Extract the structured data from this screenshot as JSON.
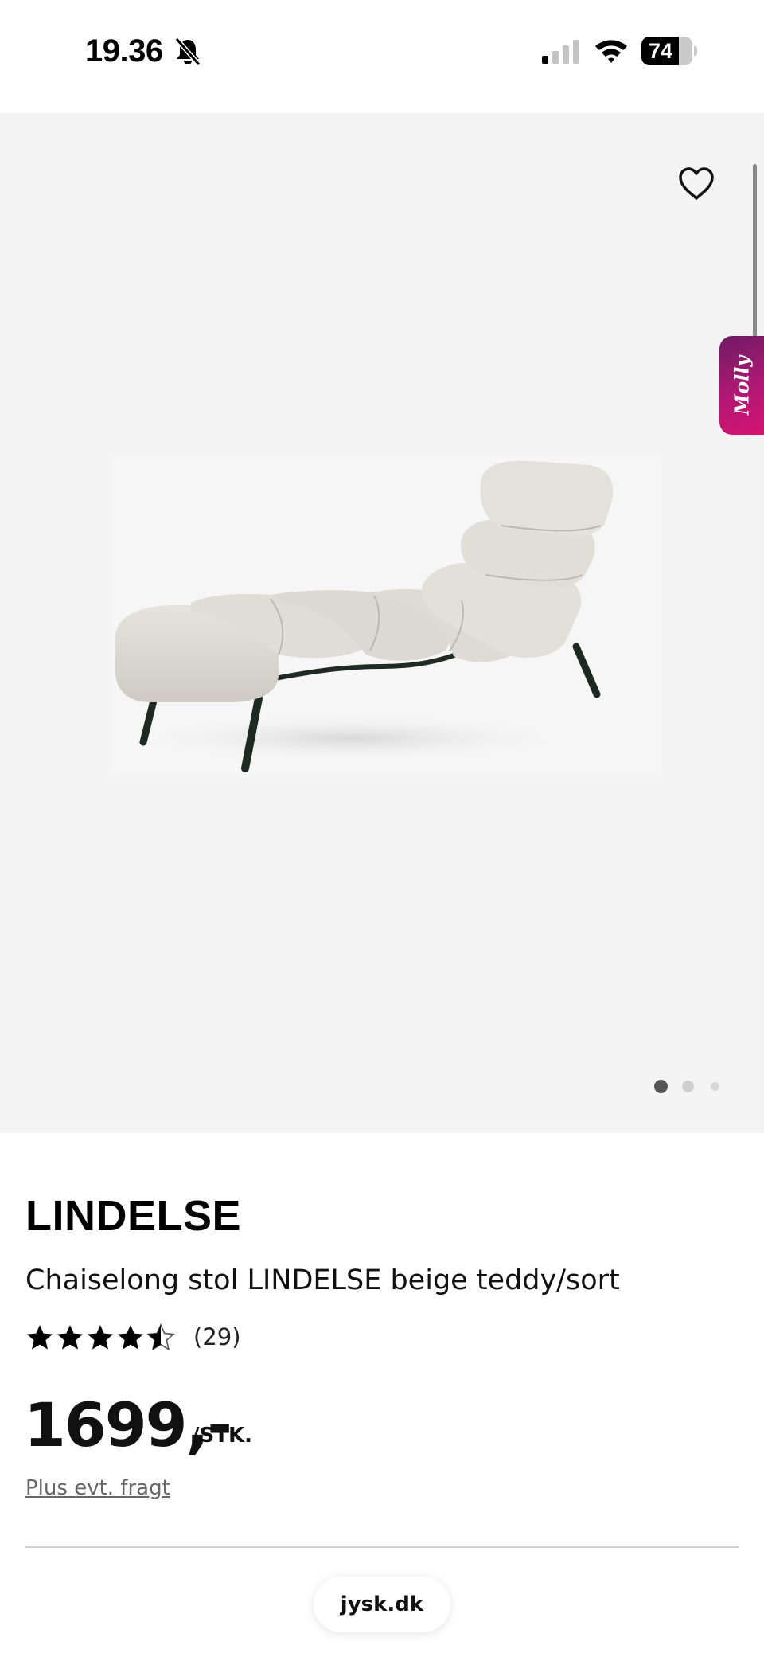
{
  "status_bar": {
    "time": "19.36",
    "battery_level": "74",
    "icons": [
      "bell-slash-icon",
      "signal-icon",
      "wifi-icon",
      "battery-icon"
    ]
  },
  "gallery": {
    "favorite_icon": "heart-outline-icon",
    "chat_widget_label": "Molly",
    "image_count": 3,
    "active_index": 0
  },
  "product": {
    "brand": "LINDELSE",
    "name": "Chaiselong stol LINDELSE beige teddy/sort",
    "rating": 4.5,
    "rating_max": 5,
    "review_count": "(29)",
    "price": "1699,-",
    "price_unit": "/STK.",
    "shipping_note": "Plus evt. fragt"
  },
  "browser": {
    "domain": "jysk.dk"
  },
  "colors": {
    "gallery_bg": "#f4f4f4",
    "molly_gradient_start": "#6e1b63",
    "molly_gradient_end": "#d4136f",
    "star": "#000000"
  }
}
